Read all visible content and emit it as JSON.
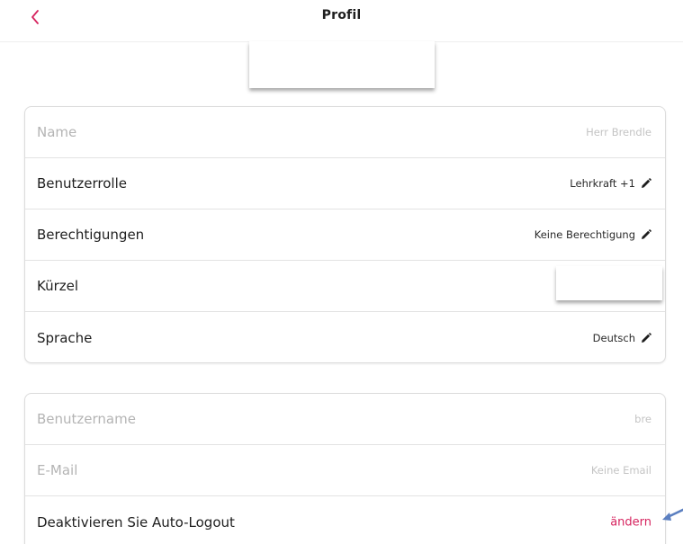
{
  "header": {
    "title": "Profil",
    "back_icon": "chevron-left-icon"
  },
  "colors": {
    "accent": "#d6245f",
    "arrow": "#5b7fc0"
  },
  "profile_card": {
    "rows": [
      {
        "label": "Name",
        "value": "Herr Brendle",
        "editable": false
      },
      {
        "label": "Benutzerrolle",
        "value": "Lehrkraft +1",
        "editable": true
      },
      {
        "label": "Berechtigungen",
        "value": "Keine Berechtigung",
        "editable": true
      },
      {
        "label": "Kürzel",
        "value": "",
        "editable": false
      },
      {
        "label": "Sprache",
        "value": "Deutsch",
        "editable": true
      }
    ]
  },
  "account_card": {
    "rows": [
      {
        "label": "Benutzername",
        "value": "bre"
      },
      {
        "label": "E-Mail",
        "value": "Keine Email"
      },
      {
        "label": "Deaktivieren Sie Auto-Logout",
        "value": "ändern"
      }
    ]
  }
}
